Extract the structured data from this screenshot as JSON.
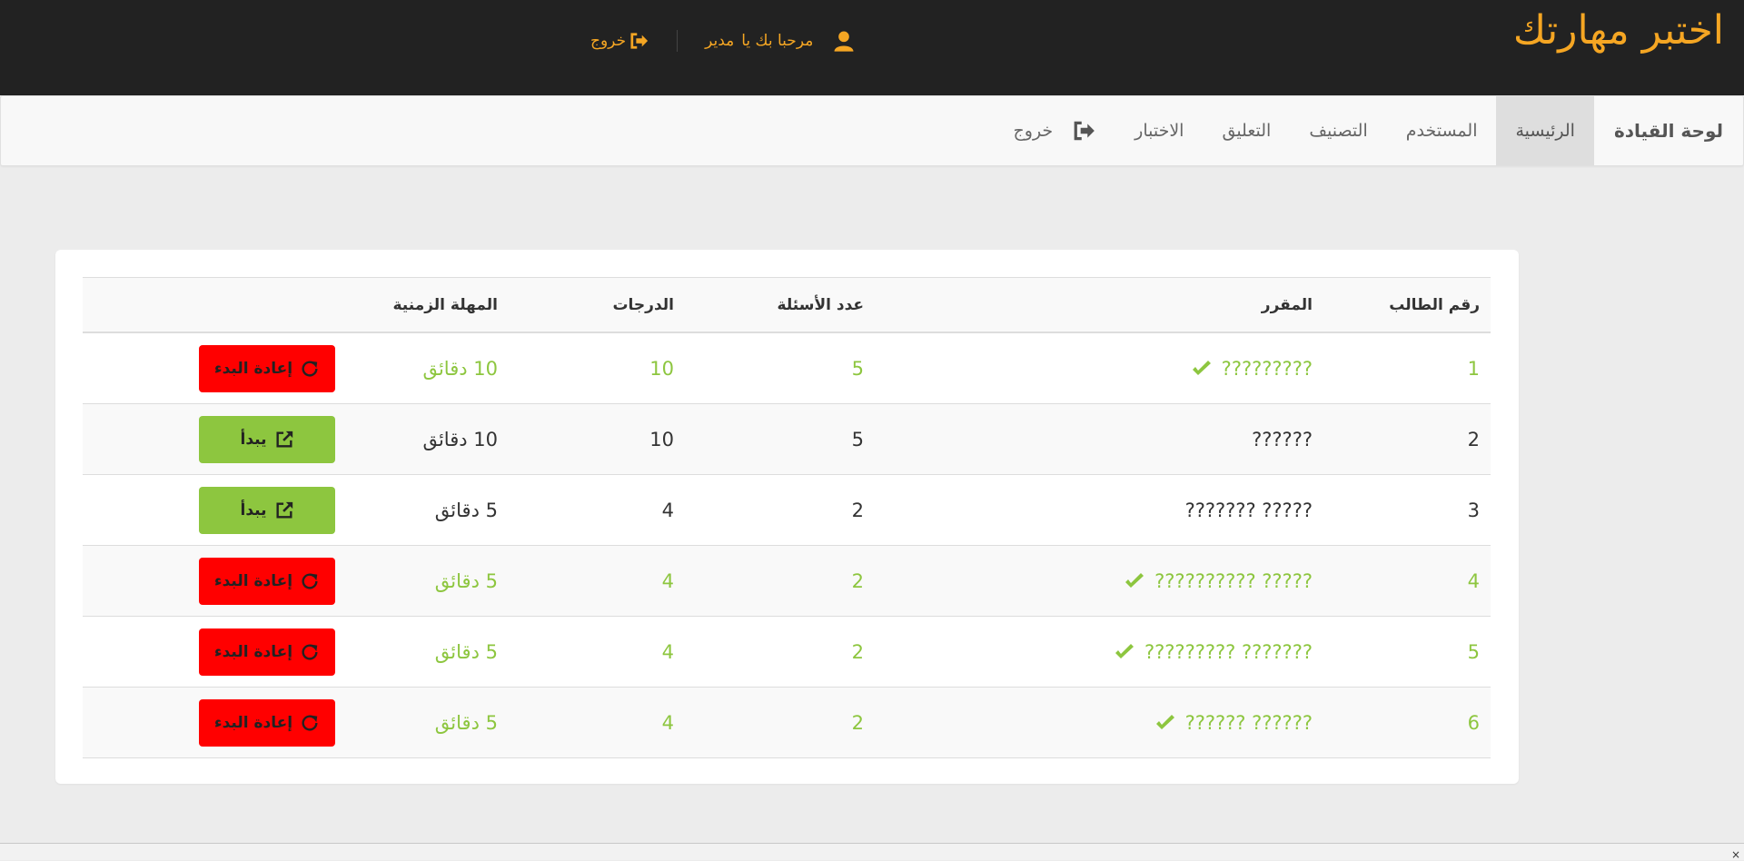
{
  "header": {
    "brand": "اختبر مهارتك",
    "welcome_prefix": "مرحبا بك يا",
    "user_name": "مدير",
    "logout_label": "خروج"
  },
  "nav": {
    "brand": "لوحة القيادة",
    "items": [
      {
        "label": "الرئيسية",
        "active": true
      },
      {
        "label": "المستخدم"
      },
      {
        "label": "التصنيف"
      },
      {
        "label": "التعليق"
      },
      {
        "label": "الاختبار"
      },
      {
        "label": "خروج",
        "icon": "logout-icon"
      }
    ]
  },
  "table": {
    "headers": [
      "رقم الطالب",
      "المقرر",
      "عدد الأسئلة",
      "الدرجات",
      "المهلة الزمنية",
      ""
    ],
    "rows": [
      {
        "id": "1",
        "course": "?????????",
        "questions": "5",
        "marks": "10",
        "time": "10 دقائق",
        "action": "إعادة البدء",
        "done": true
      },
      {
        "id": "2",
        "course": "??????",
        "questions": "5",
        "marks": "10",
        "time": "10 دقائق",
        "action": "يبدأ",
        "done": false
      },
      {
        "id": "3",
        "course": "????? ???????",
        "questions": "2",
        "marks": "4",
        "time": "5 دقائق",
        "action": "يبدأ",
        "done": false
      },
      {
        "id": "4",
        "course": "????? ??????????",
        "questions": "2",
        "marks": "4",
        "time": "5 دقائق",
        "action": "إعادة البدء",
        "done": true
      },
      {
        "id": "5",
        "course": "??????? ?????????",
        "questions": "2",
        "marks": "4",
        "time": "5 دقائق",
        "action": "إعادة البدء",
        "done": true
      },
      {
        "id": "6",
        "course": "?????? ??????",
        "questions": "2",
        "marks": "4",
        "time": "5 دقائق",
        "action": "إعادة البدء",
        "done": true
      }
    ]
  },
  "colors": {
    "accent_orange": "#f5a623",
    "done_green": "#8dc63f",
    "restart_red": "#ff0000"
  },
  "corner": "×"
}
